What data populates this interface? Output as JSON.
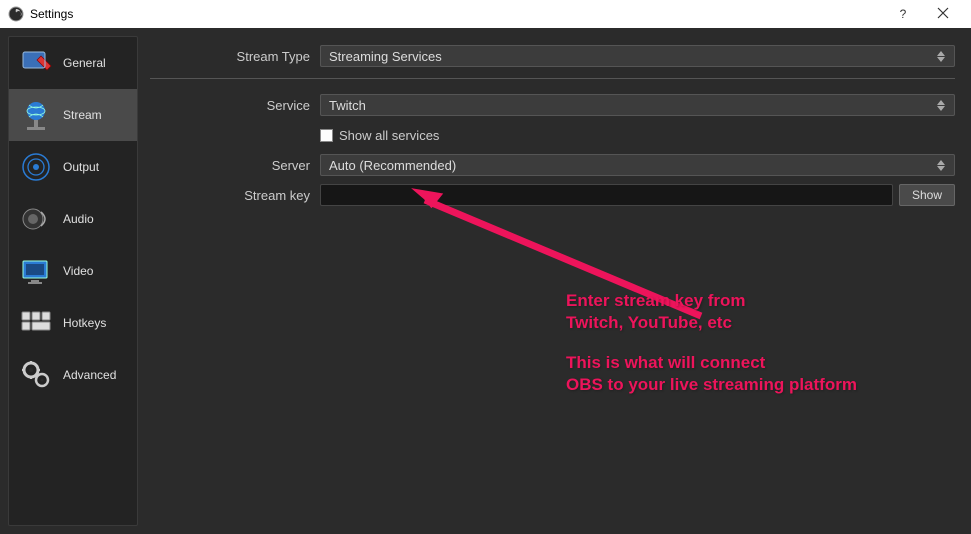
{
  "window": {
    "title": "Settings"
  },
  "sidebar": {
    "items": [
      {
        "label": "General"
      },
      {
        "label": "Stream"
      },
      {
        "label": "Output"
      },
      {
        "label": "Audio"
      },
      {
        "label": "Video"
      },
      {
        "label": "Hotkeys"
      },
      {
        "label": "Advanced"
      }
    ]
  },
  "form": {
    "stream_type_label": "Stream Type",
    "stream_type_value": "Streaming Services",
    "service_label": "Service",
    "service_value": "Twitch",
    "show_all_label": "Show all services",
    "server_label": "Server",
    "server_value": "Auto (Recommended)",
    "stream_key_label": "Stream key",
    "stream_key_value": "",
    "show_button": "Show"
  },
  "annotation": {
    "line1": "Enter stream key from",
    "line2": "Twitch, YouTube, etc",
    "line3": "This is what will connect",
    "line4": "OBS to your live streaming platform"
  }
}
